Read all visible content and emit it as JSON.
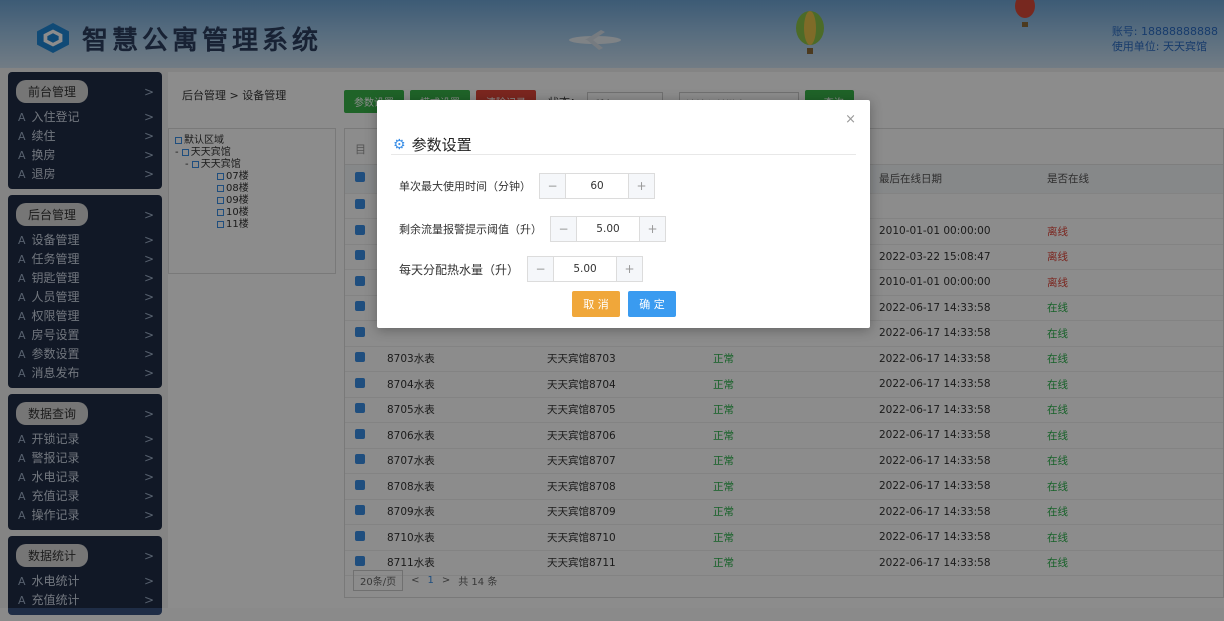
{
  "header": {
    "title": "智慧公寓管理系统",
    "account_line": "账号: 18888888888",
    "unit_line": "使用单位: 天天宾馆"
  },
  "sidebar": {
    "groups": [
      {
        "title": "前台管理",
        "items": [
          "入住登记",
          "续住",
          "换房",
          "退房"
        ]
      },
      {
        "title": "后台管理",
        "items": [
          "设备管理",
          "任务管理",
          "钥匙管理",
          "人员管理",
          "权限管理",
          "房号设置",
          "参数设置",
          "消息发布"
        ]
      },
      {
        "title": "数据查询",
        "items": [
          "开锁记录",
          "警报记录",
          "水电记录",
          "充值记录",
          "操作记录"
        ]
      },
      {
        "title": "数据统计",
        "items": [
          "水电统计",
          "充值统计"
        ]
      }
    ]
  },
  "breadcrumb": "后台管理 > 设备管理",
  "toolbar": {
    "btn1": "参数设置",
    "btn2": "模式设置",
    "btn3": "清除记录",
    "status_label": "状态：",
    "status_value": "所有",
    "search_placeholder": "请输入关键字",
    "search_btn": "查询"
  },
  "tree": {
    "root": "默认区域",
    "hotel": "天天宾馆",
    "hotel2": "天天宾馆",
    "floors": [
      "07楼",
      "08楼",
      "09楼",
      "10楼",
      "11楼"
    ]
  },
  "table": {
    "tab_first_char": "目",
    "headers": {
      "last_online": "最后在线日期",
      "online": "是否在线"
    },
    "rows": [
      {
        "name": "",
        "room": "",
        "status": "",
        "last": "",
        "online": ""
      },
      {
        "name": "",
        "room": "",
        "status": "",
        "last": "2010-01-01 00:00:00",
        "online": "离线"
      },
      {
        "name": "",
        "room": "",
        "status": "",
        "last": "2022-03-22 15:08:47",
        "online": "离线"
      },
      {
        "name": "",
        "room": "",
        "status": "",
        "last": "2010-01-01 00:00:00",
        "online": "离线"
      },
      {
        "name": "",
        "room": "",
        "status": "",
        "last": "2022-06-17 14:33:58",
        "online": "在线"
      },
      {
        "name": "",
        "room": "",
        "status": "",
        "last": "2022-06-17 14:33:58",
        "online": "在线"
      },
      {
        "name": "8703水表",
        "room": "天天宾馆8703",
        "status": "正常",
        "last": "2022-06-17 14:33:58",
        "online": "在线"
      },
      {
        "name": "8704水表",
        "room": "天天宾馆8704",
        "status": "正常",
        "last": "2022-06-17 14:33:58",
        "online": "在线"
      },
      {
        "name": "8705水表",
        "room": "天天宾馆8705",
        "status": "正常",
        "last": "2022-06-17 14:33:58",
        "online": "在线"
      },
      {
        "name": "8706水表",
        "room": "天天宾馆8706",
        "status": "正常",
        "last": "2022-06-17 14:33:58",
        "online": "在线"
      },
      {
        "name": "8707水表",
        "room": "天天宾馆8707",
        "status": "正常",
        "last": "2022-06-17 14:33:58",
        "online": "在线"
      },
      {
        "name": "8708水表",
        "room": "天天宾馆8708",
        "status": "正常",
        "last": "2022-06-17 14:33:58",
        "online": "在线"
      },
      {
        "name": "8709水表",
        "room": "天天宾馆8709",
        "status": "正常",
        "last": "2022-06-17 14:33:58",
        "online": "在线"
      },
      {
        "name": "8710水表",
        "room": "天天宾馆8710",
        "status": "正常",
        "last": "2022-06-17 14:33:58",
        "online": "在线"
      },
      {
        "name": "8711水表",
        "room": "天天宾馆8711",
        "status": "正常",
        "last": "2022-06-17 14:33:58",
        "online": "在线"
      }
    ]
  },
  "pager": {
    "page_size": "20条/页",
    "prev": "<",
    "current": "1",
    "next": ">",
    "total": "共 14 条"
  },
  "modal": {
    "title": "参数设置",
    "close": "×",
    "field1_label": "单次最大使用时间（分钟）",
    "field1_value": "60",
    "field2_label": "剩余流量报警提示阈值（升）",
    "field2_value": "5.00",
    "field3_label": "每天分配热水量（升）",
    "field3_value": "5.00",
    "minus": "−",
    "plus": "+",
    "cancel": "取 消",
    "confirm": "确 定"
  },
  "colors": {
    "accent": "#3a8ee6",
    "online": "#2bb24c",
    "offline": "#e0453a",
    "cancel": "#f0a73a"
  }
}
